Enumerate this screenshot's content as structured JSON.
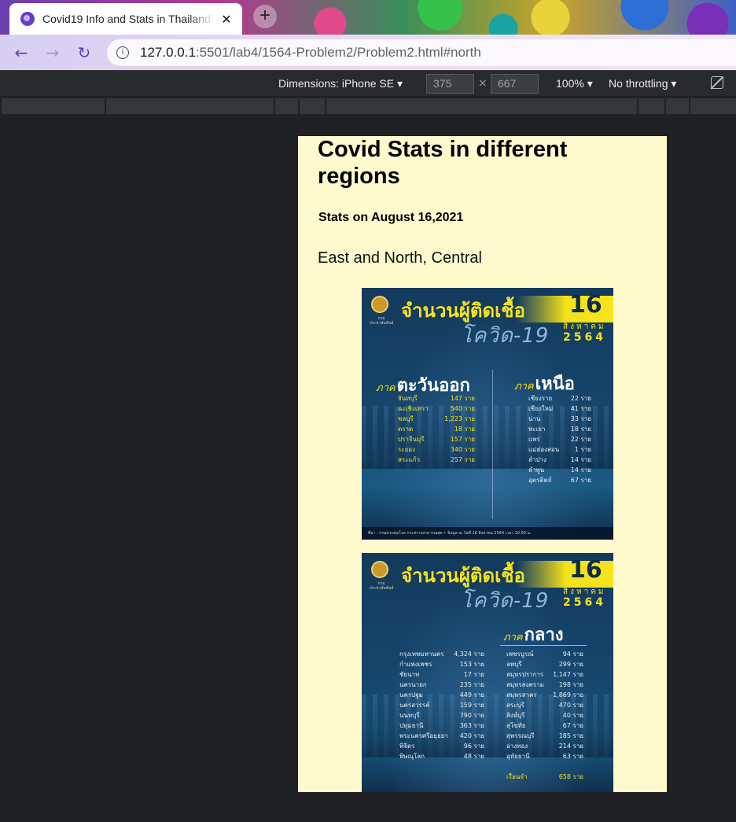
{
  "browser": {
    "tab_title": "Covid19 Info and Stats in Thailand",
    "tab_close": "✕",
    "new_tab": "+",
    "url_host": "127.0.0.1",
    "url_rest": ":5501/lab4/1564-Problem2/Problem2.html#north"
  },
  "devtools": {
    "dimensions_label": "Dimensions: iPhone SE ▾",
    "width": "375",
    "height": "667",
    "times": "×",
    "zoom": "100% ▾",
    "throttling": "No throttling ▾"
  },
  "page": {
    "title": "Covid Stats in different regions",
    "stats_date": "Stats on August 16,2021",
    "regions": "East and North, Central"
  },
  "poster_common": {
    "headline": "จำนวนผู้ติดเชื้อ",
    "sub_head": "โควิด-19",
    "day": "16",
    "month": "สิงหาคม",
    "year": "2564",
    "seal_text": "กรมประชาสัมพันธ์",
    "footer": "ที่มา : กรมควบคุมโรค กระทรวงสาธารณสุข  •  ข้อมูล ณ วันที่ 16 สิงหาคม 2564 เวลา 10.00 น."
  },
  "poster_east_north": {
    "east_prefix": "ภาค",
    "east_name": "ตะวันออก",
    "north_prefix": "ภาค",
    "north_name": "เหนือ",
    "east_rows": [
      {
        "prov": "จันทบุรี",
        "cnt": "147 ราย"
      },
      {
        "prov": "ฉะเชิงเทรา",
        "cnt": "540 ราย"
      },
      {
        "prov": "ชลบุรี",
        "cnt": "1,223 ราย"
      },
      {
        "prov": "ตราด",
        "cnt": "18 ราย"
      },
      {
        "prov": "ปราจีนบุรี",
        "cnt": "157 ราย"
      },
      {
        "prov": "ระยอง",
        "cnt": "340 ราย"
      },
      {
        "prov": "สระแก้ว",
        "cnt": "257 ราย"
      }
    ],
    "north_rows": [
      {
        "prov": "เชียงราย",
        "cnt": "22 ราย"
      },
      {
        "prov": "เชียงใหม่",
        "cnt": "41 ราย"
      },
      {
        "prov": "น่าน",
        "cnt": "33 ราย"
      },
      {
        "prov": "พะเยา",
        "cnt": "18 ราย"
      },
      {
        "prov": "แพร่",
        "cnt": "22 ราย"
      },
      {
        "prov": "แม่ฮ่องสอน",
        "cnt": "1 ราย"
      },
      {
        "prov": "ลำปาง",
        "cnt": "14 ราย"
      },
      {
        "prov": "ลำพูน",
        "cnt": "14 ราย"
      },
      {
        "prov": "อุตรดิตถ์",
        "cnt": "67 ราย"
      }
    ]
  },
  "poster_central": {
    "prefix": "ภาค",
    "name": "กลาง",
    "left_rows": [
      {
        "prov": "กรุงเทพมหานคร",
        "cnt": "4,324 ราย"
      },
      {
        "prov": "กำแพงเพชร",
        "cnt": "153 ราย"
      },
      {
        "prov": "ชัยนาท",
        "cnt": "17 ราย"
      },
      {
        "prov": "นครนายก",
        "cnt": "235 ราย"
      },
      {
        "prov": "นครปฐม",
        "cnt": "449 ราย"
      },
      {
        "prov": "นครสวรรค์",
        "cnt": "159 ราย"
      },
      {
        "prov": "นนทบุรี",
        "cnt": "790 ราย"
      },
      {
        "prov": "ปทุมธานี",
        "cnt": "363 ราย"
      },
      {
        "prov": "พระนครศรีอยุธยา",
        "cnt": "420 ราย"
      },
      {
        "prov": "พิจิตร",
        "cnt": "96 ราย"
      },
      {
        "prov": "พิษณุโลก",
        "cnt": "48 ราย"
      }
    ],
    "right_rows": [
      {
        "prov": "เพชรบูรณ์",
        "cnt": "94 ราย"
      },
      {
        "prov": "ลพบุรี",
        "cnt": "299 ราย"
      },
      {
        "prov": "สมุทรปราการ",
        "cnt": "1,147 ราย"
      },
      {
        "prov": "สมุทรสงคราม",
        "cnt": "198 ราย"
      },
      {
        "prov": "สมุทรสาคร",
        "cnt": "1,869 ราย"
      },
      {
        "prov": "สระบุรี",
        "cnt": "470 ราย"
      },
      {
        "prov": "สิงห์บุรี",
        "cnt": "40 ราย"
      },
      {
        "prov": "สุโขทัย",
        "cnt": "67 ราย"
      },
      {
        "prov": "สุพรรณบุรี",
        "cnt": "185 ราย"
      },
      {
        "prov": "อ่างทอง",
        "cnt": "214 ราย"
      },
      {
        "prov": "อุทัยธานี",
        "cnt": "63 ราย"
      }
    ],
    "total": {
      "prov": "เรือนจำ",
      "cnt": "658 ราย"
    }
  }
}
